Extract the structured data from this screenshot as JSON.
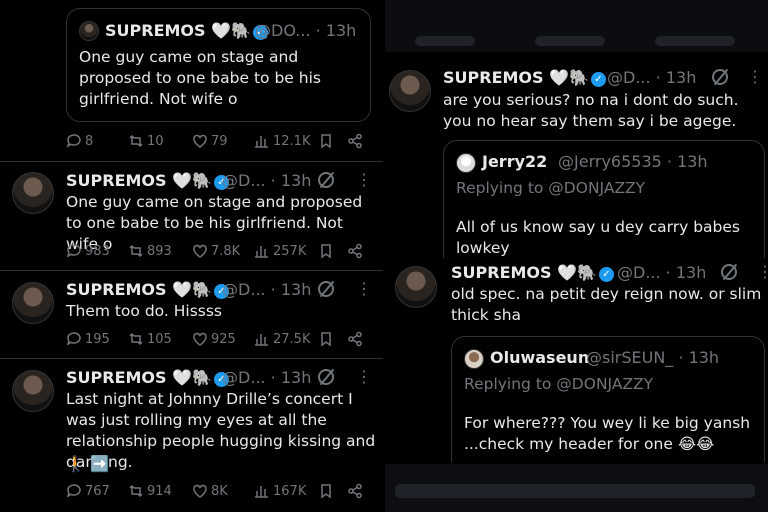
{
  "left": {
    "quoted_top": {
      "name": "SUPREMOS 🤍🐘",
      "handle": "@DO... · 13h",
      "text": "One guy came on stage and proposed to one babe to be his girlfriend. Not wife o"
    },
    "top_actions": {
      "replies": "8",
      "reposts": "10",
      "likes": "79",
      "views": "12.1K"
    },
    "tweets": [
      {
        "name": "SUPREMOS 🤍🐘",
        "handle": "@D... · 13h",
        "text": "One guy came on stage and proposed to one babe to be his girlfriend. Not wife o",
        "replies": "983",
        "reposts": "893",
        "likes": "7.8K",
        "views": "257K"
      },
      {
        "name": "SUPREMOS 🤍🐘",
        "handle": "@D... · 13h",
        "text": "Them too do. Hissss",
        "replies": "195",
        "reposts": "105",
        "likes": "925",
        "views": "27.5K"
      },
      {
        "name": "SUPREMOS 🤍🐘",
        "handle": "@D... · 13h",
        "text": "Last night at Johnny Drille’s concert I was just rolling my eyes at all the relationship people hugging kissing and dancing.",
        "emoji_line": "🚶 ➡️",
        "replies": "767",
        "reposts": "914",
        "likes": "8K",
        "views": "167K"
      }
    ]
  },
  "right": {
    "tweet1": {
      "name": "SUPREMOS 🤍🐘",
      "handle": "@D... · 13h",
      "text": "are you serious? no na i dont do such. you no hear say them say i be agege.",
      "quote": {
        "name": "Jerry22",
        "handle": "@Jerry65535 · 13h",
        "reply_to": "Replying to @DONJAZZY",
        "text": "All of us know say u dey carry babes lowkey"
      }
    },
    "tweet2": {
      "name": "SUPREMOS 🤍🐘",
      "handle": "@D... · 13h",
      "text": "old spec. na petit dey reign now. or slim thick sha",
      "quote": {
        "name": "Oluwaseun",
        "handle": "@sirSEUN_ · 13h",
        "reply_to": "Replying to @DONJAZZY",
        "text": "For where??? You wey li ke big yansh ...check my header for one 😂😂"
      }
    }
  },
  "colors": {
    "accent": "#1d9bf0",
    "muted": "#71767b",
    "text": "#e7e9ea",
    "border": "#2f3336"
  }
}
